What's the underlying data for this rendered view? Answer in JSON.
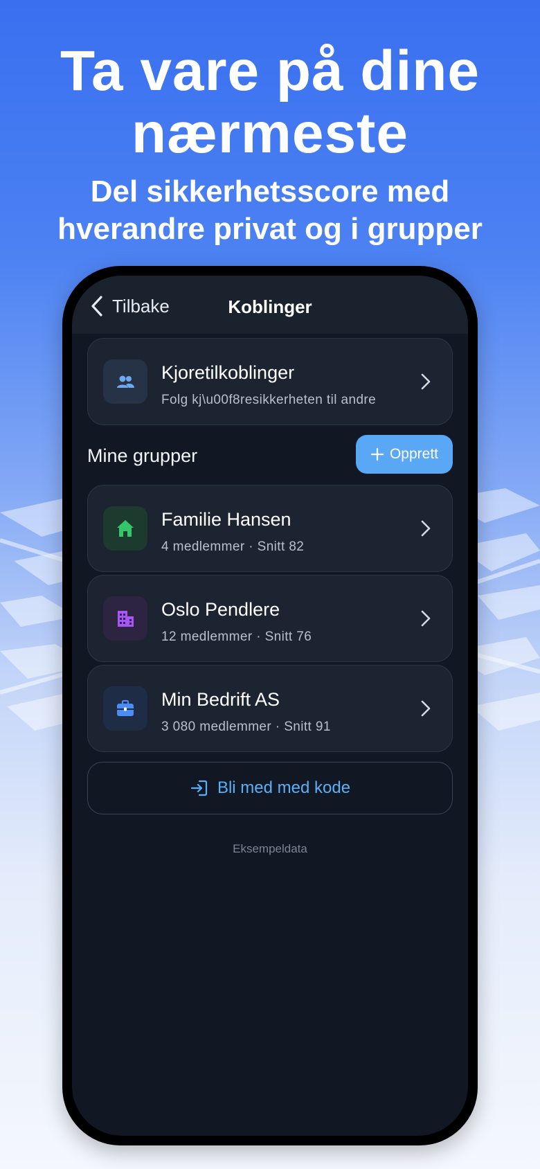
{
  "headline": "Ta vare på dine nærmeste",
  "subheadline_line1": "Del sikkerhetsscore med",
  "subheadline_line2": "hverandre privat og i grupper",
  "nav": {
    "back_label": "Tilbake",
    "title": "Koblinger"
  },
  "connections_card": {
    "title": "Kjoretilkoblinger",
    "subtitle": "Folg kj\\u00f8resikkerheten til andre",
    "icon": "people-icon"
  },
  "groups_section": {
    "title": "Mine grupper",
    "create_label": "Opprett"
  },
  "groups": [
    {
      "name": "Familie Hansen",
      "meta": "4 medlemmer · Snitt 82",
      "icon": "home-icon",
      "icon_color": "#34c76a",
      "icon_bg": "#1c3a2d"
    },
    {
      "name": "Oslo Pendlere",
      "meta": "12 medlemmer · Snitt 76",
      "icon": "building-icon",
      "icon_color": "#a855f7",
      "icon_bg": "#2c2440"
    },
    {
      "name": "Min Bedrift AS",
      "meta": "3 080 medlemmer · Snitt 91",
      "icon": "briefcase-icon",
      "icon_color": "#4a8ef5",
      "icon_bg": "#1f2c45"
    }
  ],
  "join_button_label": "Bli med med kode",
  "footnote": "Eksempeldata",
  "colors": {
    "accent": "#5aa8f5",
    "link": "#5ab0f7",
    "screen_bg": "#111824",
    "card_bg": "#1c2431"
  }
}
